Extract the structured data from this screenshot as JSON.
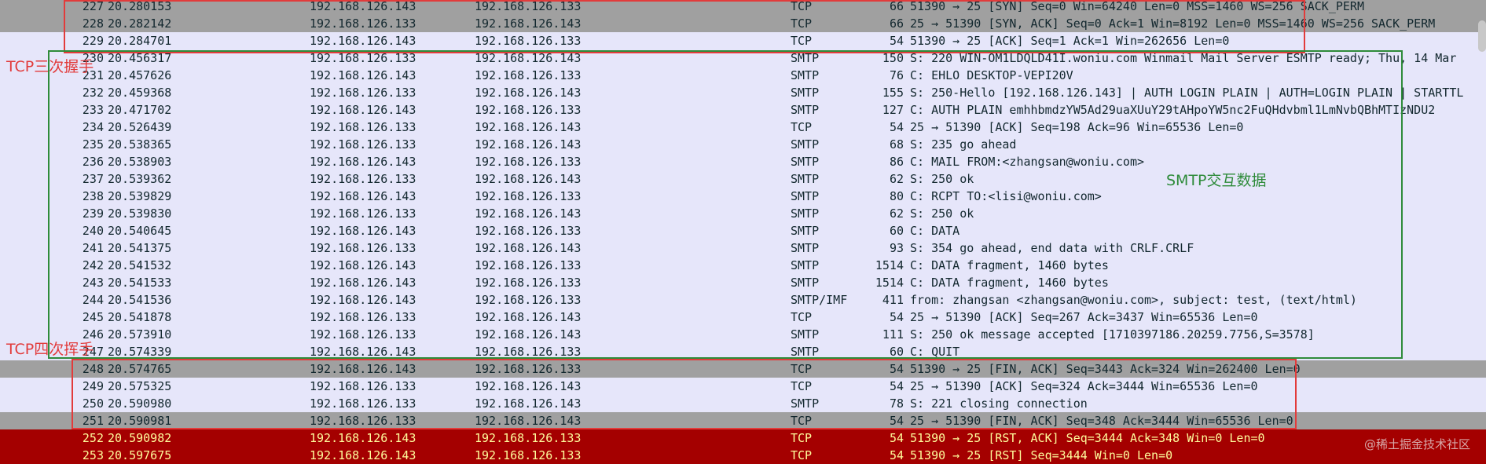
{
  "colors": {
    "row_default": "#e6e6fa",
    "row_tcp_flagged": "#a0a0a0",
    "row_error": "#a40000",
    "text_default": "#12272e",
    "text_error": "#fffc9c",
    "handshake_box": "#e23b3b",
    "smtp_box": "#2e8b3a",
    "teardown_box": "#e23b3b"
  },
  "annotations": {
    "handshake": "TCP三次握手",
    "smtp": "SMTP交互数据",
    "teardown": "TCP四次挥手"
  },
  "watermark": "@稀土掘金技术社区",
  "packets": [
    {
      "no": "227",
      "time": "20.280153",
      "src": "192.168.126.143",
      "dst": "192.168.126.133",
      "proto": "TCP",
      "len": "66",
      "info": "51390 → 25 [SYN] Seq=0 Win=64240 Len=0 MSS=1460 WS=256 SACK_PERM",
      "style": "tcp_flagged"
    },
    {
      "no": "228",
      "time": "20.282142",
      "src": "192.168.126.133",
      "dst": "192.168.126.143",
      "proto": "TCP",
      "len": "66",
      "info": "25 → 51390 [SYN, ACK] Seq=0 Ack=1 Win=8192 Len=0 MSS=1460 WS=256 SACK_PERM",
      "style": "tcp_flagged"
    },
    {
      "no": "229",
      "time": "20.284701",
      "src": "192.168.126.143",
      "dst": "192.168.126.133",
      "proto": "TCP",
      "len": "54",
      "info": "51390 → 25 [ACK] Seq=1 Ack=1 Win=262656 Len=0",
      "style": "default"
    },
    {
      "no": "230",
      "time": "20.456317",
      "src": "192.168.126.133",
      "dst": "192.168.126.143",
      "proto": "SMTP",
      "len": "150",
      "info": "S: 220 WIN-OM1LDQLD41I.woniu.com Winmail Mail Server ESMTP ready; Thu, 14 Mar",
      "style": "default"
    },
    {
      "no": "231",
      "time": "20.457626",
      "src": "192.168.126.143",
      "dst": "192.168.126.133",
      "proto": "SMTP",
      "len": "76",
      "info": "C: EHLO DESKTOP-VEPI20V",
      "style": "default"
    },
    {
      "no": "232",
      "time": "20.459368",
      "src": "192.168.126.133",
      "dst": "192.168.126.143",
      "proto": "SMTP",
      "len": "155",
      "info": "S: 250-Hello [192.168.126.143] | AUTH LOGIN PLAIN | AUTH=LOGIN PLAIN | STARTTL",
      "style": "default"
    },
    {
      "no": "233",
      "time": "20.471702",
      "src": "192.168.126.143",
      "dst": "192.168.126.133",
      "proto": "SMTP",
      "len": "127",
      "info": "C: AUTH PLAIN emhhbmdzYW5Ad29uaXUuY29tAHpoYW5nc2FuQHdvbml1LmNvbQBhMTIzNDU2",
      "style": "default"
    },
    {
      "no": "234",
      "time": "20.526439",
      "src": "192.168.126.133",
      "dst": "192.168.126.143",
      "proto": "TCP",
      "len": "54",
      "info": "25 → 51390 [ACK] Seq=198 Ack=96 Win=65536 Len=0",
      "style": "default"
    },
    {
      "no": "235",
      "time": "20.538365",
      "src": "192.168.126.133",
      "dst": "192.168.126.143",
      "proto": "SMTP",
      "len": "68",
      "info": "S: 235 go ahead",
      "style": "default"
    },
    {
      "no": "236",
      "time": "20.538903",
      "src": "192.168.126.143",
      "dst": "192.168.126.133",
      "proto": "SMTP",
      "len": "86",
      "info": "C: MAIL FROM:<zhangsan@woniu.com>",
      "style": "default"
    },
    {
      "no": "237",
      "time": "20.539362",
      "src": "192.168.126.133",
      "dst": "192.168.126.143",
      "proto": "SMTP",
      "len": "62",
      "info": "S: 250 ok",
      "style": "default"
    },
    {
      "no": "238",
      "time": "20.539829",
      "src": "192.168.126.143",
      "dst": "192.168.126.133",
      "proto": "SMTP",
      "len": "80",
      "info": "C: RCPT TO:<lisi@woniu.com>",
      "style": "default"
    },
    {
      "no": "239",
      "time": "20.539830",
      "src": "192.168.126.133",
      "dst": "192.168.126.143",
      "proto": "SMTP",
      "len": "62",
      "info": "S: 250 ok",
      "style": "default"
    },
    {
      "no": "240",
      "time": "20.540645",
      "src": "192.168.126.143",
      "dst": "192.168.126.133",
      "proto": "SMTP",
      "len": "60",
      "info": "C: DATA",
      "style": "default"
    },
    {
      "no": "241",
      "time": "20.541375",
      "src": "192.168.126.133",
      "dst": "192.168.126.143",
      "proto": "SMTP",
      "len": "93",
      "info": "S: 354 go ahead, end data with CRLF.CRLF",
      "style": "default"
    },
    {
      "no": "242",
      "time": "20.541532",
      "src": "192.168.126.143",
      "dst": "192.168.126.133",
      "proto": "SMTP",
      "len": "1514",
      "info": "C: DATA fragment, 1460 bytes",
      "style": "default"
    },
    {
      "no": "243",
      "time": "20.541533",
      "src": "192.168.126.143",
      "dst": "192.168.126.133",
      "proto": "SMTP",
      "len": "1514",
      "info": "C: DATA fragment, 1460 bytes",
      "style": "default"
    },
    {
      "no": "244",
      "time": "20.541536",
      "src": "192.168.126.143",
      "dst": "192.168.126.133",
      "proto": "SMTP/IMF",
      "len": "411",
      "info": "from: zhangsan <zhangsan@woniu.com>, subject: test,  (text/html)",
      "style": "default"
    },
    {
      "no": "245",
      "time": "20.541878",
      "src": "192.168.126.133",
      "dst": "192.168.126.143",
      "proto": "TCP",
      "len": "54",
      "info": "25 → 51390 [ACK] Seq=267 Ack=3437 Win=65536 Len=0",
      "style": "default"
    },
    {
      "no": "246",
      "time": "20.573910",
      "src": "192.168.126.133",
      "dst": "192.168.126.143",
      "proto": "SMTP",
      "len": "111",
      "info": "S: 250 ok message accepted [1710397186.20259.7756,S=3578]",
      "style": "default"
    },
    {
      "no": "247",
      "time": "20.574339",
      "src": "192.168.126.143",
      "dst": "192.168.126.133",
      "proto": "SMTP",
      "len": "60",
      "info": "C: QUIT",
      "style": "default"
    },
    {
      "no": "248",
      "time": "20.574765",
      "src": "192.168.126.143",
      "dst": "192.168.126.133",
      "proto": "TCP",
      "len": "54",
      "info": "51390 → 25 [FIN, ACK] Seq=3443 Ack=324 Win=262400 Len=0",
      "style": "tcp_flagged"
    },
    {
      "no": "249",
      "time": "20.575325",
      "src": "192.168.126.133",
      "dst": "192.168.126.143",
      "proto": "TCP",
      "len": "54",
      "info": "25 → 51390 [ACK] Seq=324 Ack=3444 Win=65536 Len=0",
      "style": "default"
    },
    {
      "no": "250",
      "time": "20.590980",
      "src": "192.168.126.133",
      "dst": "192.168.126.143",
      "proto": "SMTP",
      "len": "78",
      "info": "S: 221 closing connection",
      "style": "default"
    },
    {
      "no": "251",
      "time": "20.590981",
      "src": "192.168.126.133",
      "dst": "192.168.126.143",
      "proto": "TCP",
      "len": "54",
      "info": "25 → 51390 [FIN, ACK] Seq=348 Ack=3444 Win=65536 Len=0",
      "style": "tcp_flagged"
    },
    {
      "no": "252",
      "time": "20.590982",
      "src": "192.168.126.143",
      "dst": "192.168.126.133",
      "proto": "TCP",
      "len": "54",
      "info": "51390 → 25 [RST, ACK] Seq=3444 Ack=348 Win=0 Len=0",
      "style": "error"
    },
    {
      "no": "253",
      "time": "20.597675",
      "src": "192.168.126.143",
      "dst": "192.168.126.133",
      "proto": "TCP",
      "len": "54",
      "info": "51390 → 25 [RST] Seq=3444 Win=0 Len=0",
      "style": "error"
    }
  ]
}
